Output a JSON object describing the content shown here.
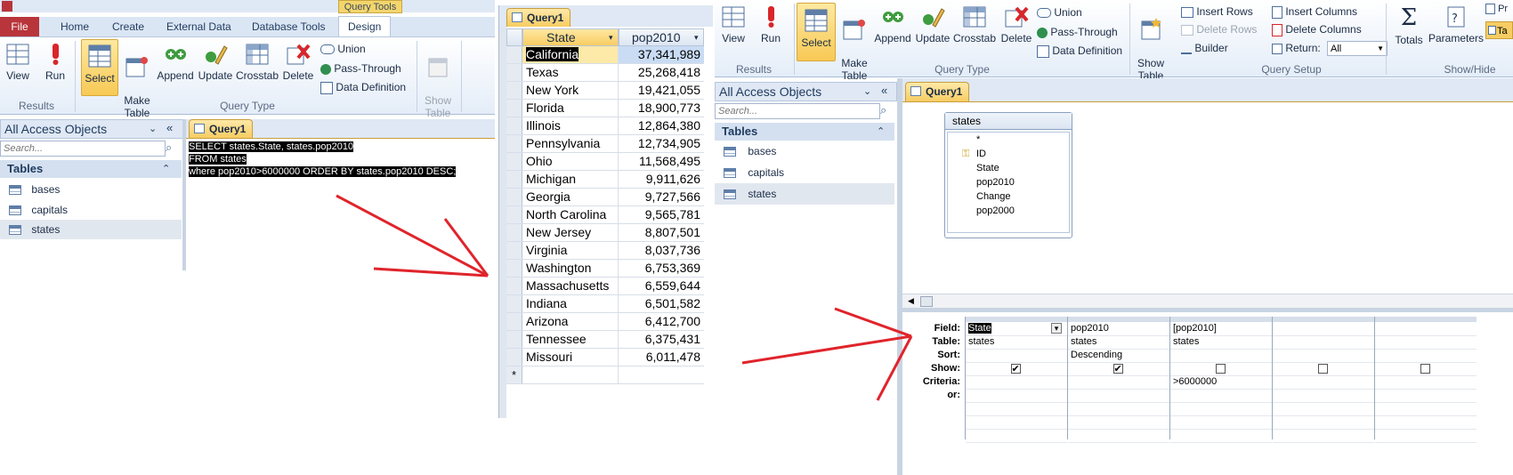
{
  "left": {
    "context_tab": "Query Tools",
    "tabs": [
      "File",
      "Home",
      "Create",
      "External Data",
      "Database Tools",
      "Design"
    ],
    "results": {
      "group": "Results",
      "view": "View",
      "run": "Run"
    },
    "query_type": {
      "group": "Query Type",
      "buttons": [
        "Select",
        "Make\nTable",
        "Append",
        "Update",
        "Crosstab",
        "Delete"
      ],
      "union": "Union",
      "pass_through": "Pass-Through",
      "data_definition": "Data Definition"
    },
    "show_table": "Show\nTable",
    "nav": {
      "header": "All Access Objects",
      "search_placeholder": "Search...",
      "section": "Tables",
      "items": [
        "bases",
        "capitals",
        "states"
      ]
    },
    "doc_tab": "Query1",
    "sql": [
      "SELECT states.State, states.pop2010",
      "FROM states",
      "where pop2010>6000000 ORDER BY states.pop2010 DESC;"
    ]
  },
  "middle": {
    "doc_tab": "Query1",
    "columns": [
      "State",
      "pop2010"
    ],
    "rows": [
      [
        "California",
        "37,341,989"
      ],
      [
        "Texas",
        "25,268,418"
      ],
      [
        "New York",
        "19,421,055"
      ],
      [
        "Florida",
        "18,900,773"
      ],
      [
        "Illinois",
        "12,864,380"
      ],
      [
        "Pennsylvania",
        "12,734,905"
      ],
      [
        "Ohio",
        "11,568,495"
      ],
      [
        "Michigan",
        "9,911,626"
      ],
      [
        "Georgia",
        "9,727,566"
      ],
      [
        "North Carolina",
        "9,565,781"
      ],
      [
        "New Jersey",
        "8,807,501"
      ],
      [
        "Virginia",
        "8,037,736"
      ],
      [
        "Washington",
        "6,753,369"
      ],
      [
        "Massachusetts",
        "6,559,644"
      ],
      [
        "Indiana",
        "6,501,582"
      ],
      [
        "Arizona",
        "6,412,700"
      ],
      [
        "Tennessee",
        "6,375,431"
      ],
      [
        "Missouri",
        "6,011,478"
      ]
    ],
    "new_row_marker": "*"
  },
  "right": {
    "results": {
      "group": "Results",
      "view": "View",
      "run": "Run"
    },
    "query_type": {
      "group": "Query Type",
      "buttons": [
        "Select",
        "Make\nTable",
        "Append",
        "Update",
        "Crosstab",
        "Delete"
      ],
      "union": "Union",
      "pass_through": "Pass-Through",
      "data_definition": "Data Definition"
    },
    "query_setup": {
      "group": "Query Setup",
      "show_table": "Show\nTable",
      "insert_rows": "Insert Rows",
      "delete_rows": "Delete Rows",
      "builder": "Builder",
      "insert_columns": "Insert Columns",
      "delete_columns": "Delete Columns",
      "return_label": "Return:",
      "return_value": "All"
    },
    "show_hide": {
      "group": "Show/Hide",
      "totals": "Totals",
      "parameters": "Parameters",
      "pr": "Pr",
      "ta": "Ta"
    },
    "nav": {
      "header": "All Access Objects",
      "search_placeholder": "Search...",
      "section": "Tables",
      "items": [
        "bases",
        "capitals",
        "states"
      ]
    },
    "doc_tab": "Query1",
    "field_list": {
      "title": "states",
      "fields": [
        "*",
        "ID",
        "State",
        "pop2010",
        "Change",
        "pop2000"
      ]
    },
    "grid": {
      "row_labels": [
        "Field:",
        "Table:",
        "Sort:",
        "Show:",
        "Criteria:",
        "or:"
      ],
      "columns": [
        {
          "field": "State",
          "table": "states",
          "sort": "",
          "show": true,
          "criteria": ""
        },
        {
          "field": "pop2010",
          "table": "states",
          "sort": "Descending",
          "show": true,
          "criteria": ""
        },
        {
          "field": "[pop2010]",
          "table": "states",
          "sort": "",
          "show": false,
          "criteria": ">6000000"
        },
        {
          "field": "",
          "table": "",
          "sort": "",
          "show": false,
          "criteria": ""
        },
        {
          "field": "",
          "table": "",
          "sort": "",
          "show": false,
          "criteria": ""
        }
      ]
    }
  },
  "colors": {
    "arrow": "#e0242b",
    "file_tab": "#b8353b",
    "select_highlight": "#f8c955",
    "context_tab": "#f3d56b"
  }
}
